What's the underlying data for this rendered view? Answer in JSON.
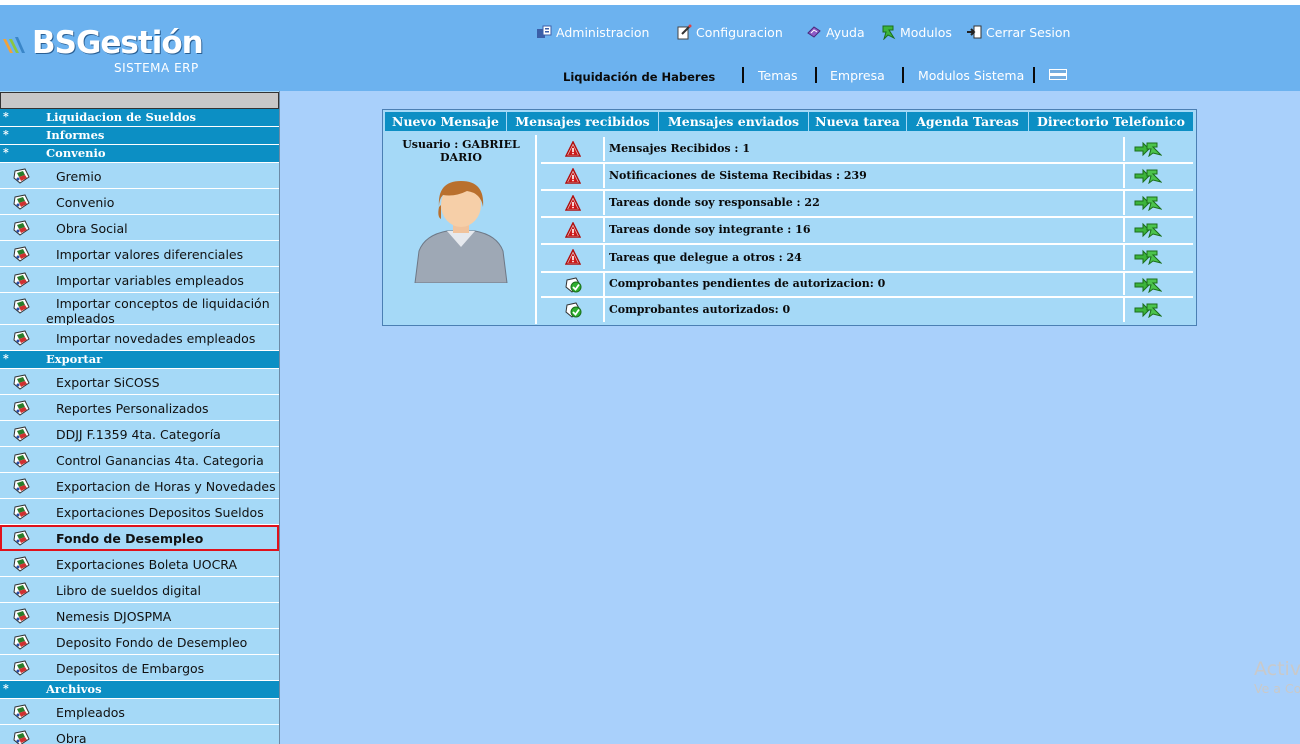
{
  "brand": {
    "name": "BSGestión",
    "subtitle": "SISTEMA ERP"
  },
  "top_nav": [
    {
      "label": "Administracion",
      "icon": "admin-icon"
    },
    {
      "label": "Configuracion",
      "icon": "config-icon"
    },
    {
      "label": "Ayuda",
      "icon": "help-icon"
    },
    {
      "label": "Modulos",
      "icon": "modules-icon"
    },
    {
      "label": "Cerrar Sesion",
      "icon": "logout-icon"
    }
  ],
  "sub_nav": {
    "title": "Liquidación de Haberes",
    "links": [
      "Temas",
      "Empresa",
      "Modulos Sistema"
    ],
    "flag_icon": "argentina-flag-icon"
  },
  "sidebar": {
    "star": "*",
    "sections": [
      {
        "type": "category",
        "label": "Liquidacion de Sueldos"
      },
      {
        "type": "category",
        "label": "Informes"
      },
      {
        "type": "category",
        "label": "Convenio"
      },
      {
        "type": "item",
        "label": "Gremio"
      },
      {
        "type": "item",
        "label": "Convenio"
      },
      {
        "type": "item",
        "label": "Obra Social"
      },
      {
        "type": "item",
        "label": "Importar valores diferenciales"
      },
      {
        "type": "item",
        "label": "Importar variables empleados"
      },
      {
        "type": "item",
        "label": "Importar conceptos de liquidación empleados"
      },
      {
        "type": "item",
        "label": "Importar novedades empleados"
      },
      {
        "type": "category",
        "label": "Exportar"
      },
      {
        "type": "item",
        "label": "Exportar SiCOSS"
      },
      {
        "type": "item",
        "label": "Reportes Personalizados"
      },
      {
        "type": "item",
        "label": "DDJJ F.1359 4ta. Categoría"
      },
      {
        "type": "item",
        "label": "Control Ganancias 4ta. Categoria"
      },
      {
        "type": "item",
        "label": "Exportacion de Horas y Novedades"
      },
      {
        "type": "item",
        "label": "Exportaciones Depositos Sueldos"
      },
      {
        "type": "item",
        "label": "Fondo de Desempleo",
        "active": true
      },
      {
        "type": "item",
        "label": "Exportaciones Boleta UOCRA"
      },
      {
        "type": "item",
        "label": "Libro de sueldos digital"
      },
      {
        "type": "item",
        "label": "Nemesis DJOSPMA"
      },
      {
        "type": "item",
        "label": "Deposito Fondo de Desempleo"
      },
      {
        "type": "item",
        "label": "Depositos de Embargos"
      },
      {
        "type": "category",
        "label": "Archivos"
      },
      {
        "type": "item",
        "label": "Empleados"
      },
      {
        "type": "item",
        "label": "Obra"
      }
    ]
  },
  "tabs": [
    "Nuevo Mensaje",
    "Mensajes recibidos",
    "Mensajes enviados",
    "Nueva tarea",
    "Agenda Tareas",
    "Directorio Telefonico"
  ],
  "user": {
    "name": "Usuario : GABRIEL DARIO",
    "avatar_icon": "user-avatar-icon"
  },
  "notifications": [
    {
      "text": "Mensajes Recibidos : 1",
      "status": "warning"
    },
    {
      "text": "Notificaciones de Sistema Recibidas : 239",
      "status": "warning"
    },
    {
      "text": "Tareas donde soy responsable : 22",
      "status": "warning"
    },
    {
      "text": "Tareas donde soy integrante : 16",
      "status": "warning"
    },
    {
      "text": "Tareas que delegue a otros : 24",
      "status": "warning"
    },
    {
      "text": "Comprobantes pendientes de autorizacion: 0",
      "status": "ok"
    },
    {
      "text": "Comprobantes autorizados: 0",
      "status": "ok"
    }
  ],
  "watermark": {
    "line1": "Activ",
    "line2": "Ve a Co"
  },
  "colors": {
    "header_bg": "#6cb2ef",
    "category_bg": "#0c8fc4",
    "item_bg": "#a5d9f7",
    "content_bg": "#a9d0fb",
    "active_border": "#e0121b"
  }
}
